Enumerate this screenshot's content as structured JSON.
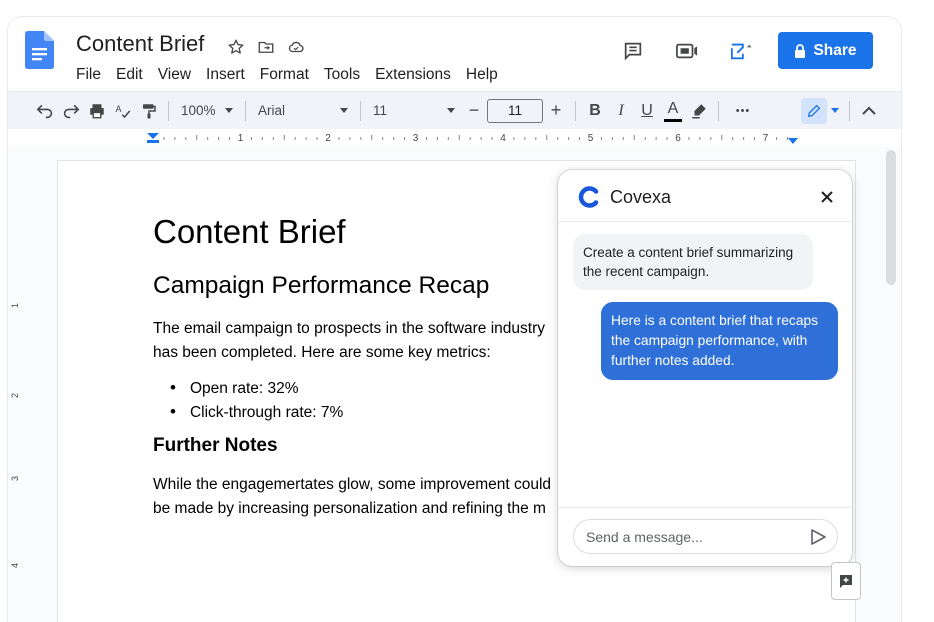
{
  "header": {
    "title": "Content Brief",
    "menu": [
      "File",
      "Edit",
      "View",
      "Insert",
      "Format",
      "Tools",
      "Extensions",
      "Help"
    ],
    "share_label": "Share"
  },
  "toolbar": {
    "zoom": "100%",
    "font": "Arial",
    "style_size": "11",
    "font_size": "11",
    "minus": "−",
    "plus": "+",
    "bold": "B",
    "italic": "I",
    "underline": "U",
    "text_color": "A",
    "more": "•••"
  },
  "ruler": {
    "marks": [
      "1",
      "2",
      "3",
      "4",
      "5",
      "6",
      "7"
    ]
  },
  "document": {
    "h1": "Content Brief",
    "h2": "Campaign Performance Recap",
    "p1": "The email campaign to prospects in the software industry has been completed. Here are some key metrics:",
    "bullets": [
      "Open rate: 32%",
      "Click-through rate: 7%"
    ],
    "h3": "Further Notes",
    "p2_line1": "While the engagemertates glow, some improvement could",
    "p2_line2": "be made by increasing personalization and refining the m"
  },
  "chat": {
    "name": "Covexa",
    "user_message": "Create a content brief summarizing the recent campaign.",
    "bot_message": "Here is a content brief that recaps the campaign performance, with further notes added.",
    "input_placeholder": "Send a message..."
  },
  "colors": {
    "accent": "#1a73e8",
    "bot_bubble": "#2e6fd8",
    "toolbar_bg": "#f0f4f9"
  }
}
